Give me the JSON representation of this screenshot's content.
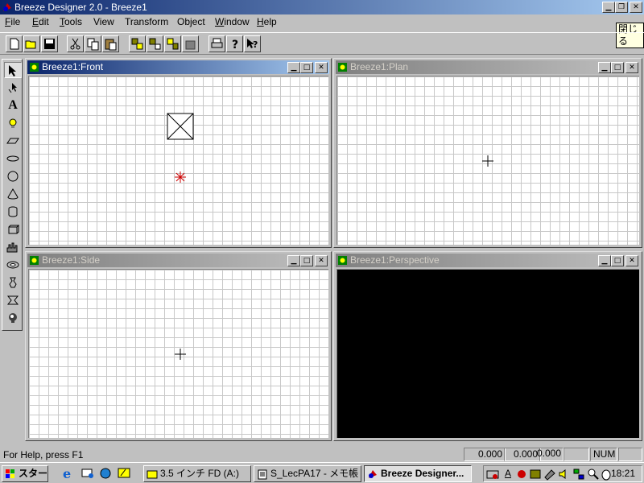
{
  "app": {
    "title": "Breeze Designer 2.0 - Breeze1"
  },
  "menu": [
    {
      "label": "File",
      "key": "F"
    },
    {
      "label": "Edit",
      "key": "E"
    },
    {
      "label": "Tools",
      "key": "T"
    },
    {
      "label": "View",
      "key": ""
    },
    {
      "label": "Transform",
      "key": ""
    },
    {
      "label": "Object",
      "key": ""
    },
    {
      "label": "Window",
      "key": "W"
    },
    {
      "label": "Help",
      "key": "H"
    }
  ],
  "tooltip": "閉じる",
  "toolbar": [
    "new-icon",
    "open-icon",
    "save-icon",
    "cut-icon",
    "copy-icon",
    "paste-icon",
    "group-icon",
    "ungroup-icon",
    "link-icon",
    "delete-icon",
    "print-icon",
    "help-icon",
    "context-help-icon"
  ],
  "tools": [
    "pointer-icon",
    "move-icon",
    "text-icon",
    "light-icon",
    "plane-icon",
    "disc-icon",
    "sphere-icon",
    "cone-icon",
    "cylinder-icon",
    "box-icon",
    "height-field-icon",
    "torus-icon",
    "lathe-icon",
    "extrude-icon",
    "blob-icon"
  ],
  "text_tool_label": "A",
  "viewports": {
    "front": {
      "title": "Breeze1:Front"
    },
    "plan": {
      "title": "Breeze1:Plan"
    },
    "side": {
      "title": "Breeze1:Side"
    },
    "perspective": {
      "title": "Breeze1:Perspective"
    }
  },
  "status": {
    "help": "For Help, press F1",
    "x": "0.000",
    "y": "0.000",
    "z": "0.000",
    "num": "NUM"
  },
  "taskbar": {
    "start": "スタート",
    "tasks": [
      {
        "label": "3.5 インチ FD (A:)"
      },
      {
        "label": "S_LecPA17 - メモ帳"
      },
      {
        "label": "Breeze Designer..."
      }
    ],
    "ime": "A",
    "clock": "18:21"
  },
  "colors": {
    "title_active": "#0a246a",
    "title_gradient_end": "#a6caf0",
    "light_source": "#cc0000",
    "perspective_bg": "#000000"
  }
}
